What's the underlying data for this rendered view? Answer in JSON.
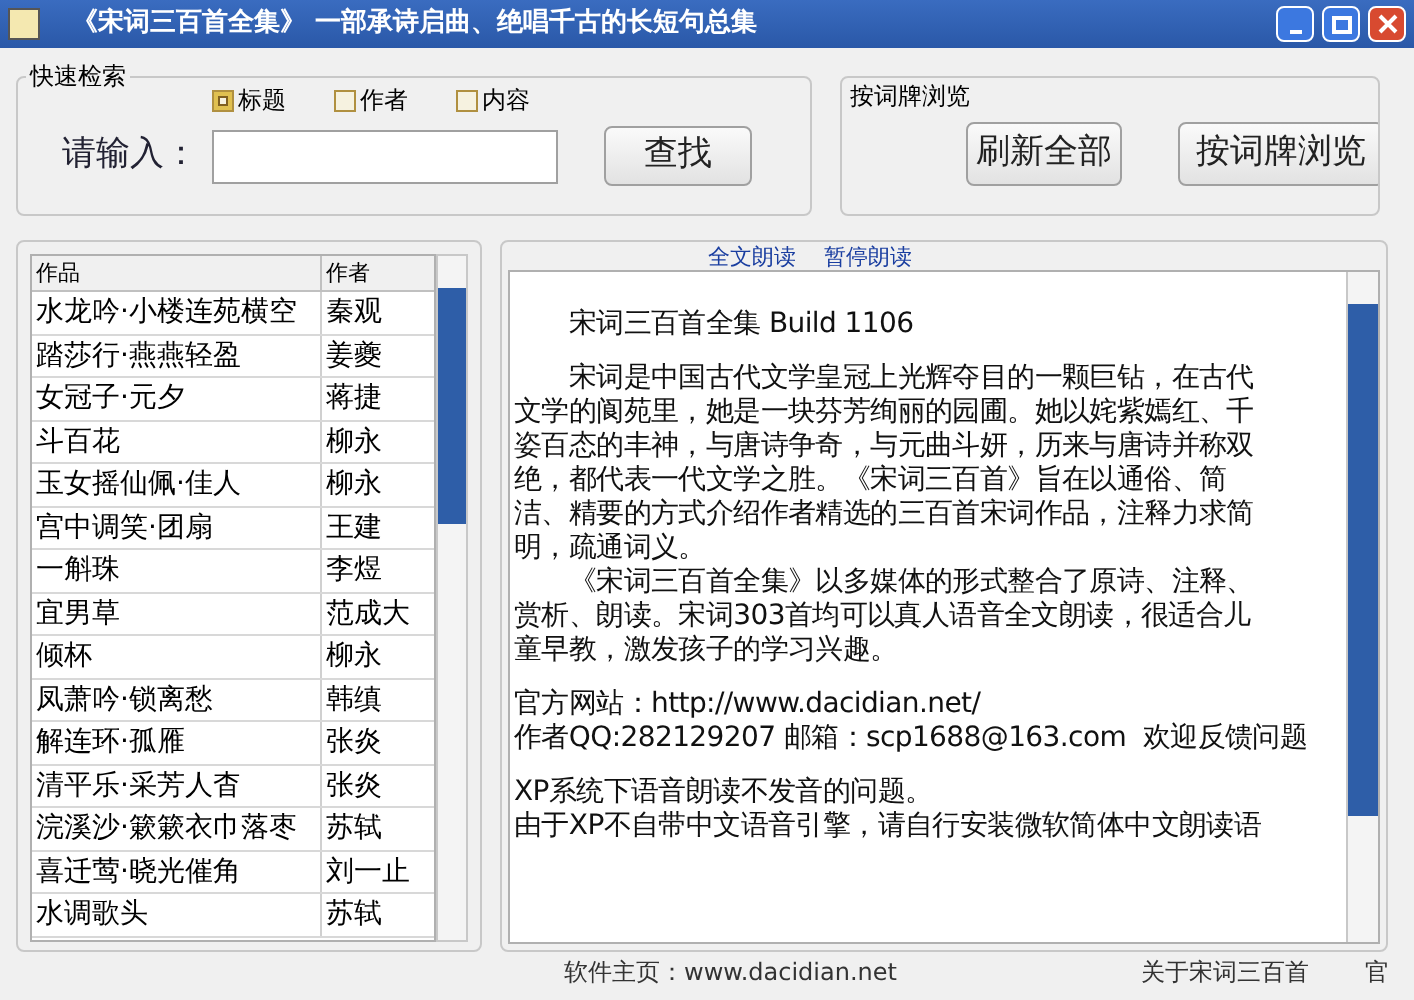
{
  "window": {
    "title": "《宋词三百首全集》 一部承诗启曲、绝唱千古的长短句总集"
  },
  "search": {
    "title": "快速检索",
    "options": [
      {
        "label": "标题",
        "checked": true
      },
      {
        "label": "作者",
        "checked": false
      },
      {
        "label": "内容",
        "checked": false
      }
    ],
    "prompt": "请输入：",
    "button": "查找"
  },
  "browse": {
    "title": "按词牌浏览",
    "buttons": [
      "刷新全部",
      "按词牌浏览"
    ]
  },
  "table": {
    "columns": [
      "作品",
      "作者"
    ],
    "rows": [
      {
        "title": "水龙吟·小楼连苑横空",
        "author": "秦观"
      },
      {
        "title": "踏莎行·燕燕轻盈",
        "author": "姜夔"
      },
      {
        "title": "女冠子·元夕",
        "author": "蒋捷"
      },
      {
        "title": "斗百花",
        "author": "柳永"
      },
      {
        "title": "玉女摇仙佩·佳人",
        "author": "柳永"
      },
      {
        "title": "宫中调笑·团扇",
        "author": "王建"
      },
      {
        "title": "一斛珠",
        "author": "李煜"
      },
      {
        "title": "宜男草",
        "author": "范成大"
      },
      {
        "title": "倾杯",
        "author": "柳永"
      },
      {
        "title": "凤萧吟·锁离愁",
        "author": "韩缜"
      },
      {
        "title": "解连环·孤雁",
        "author": "张炎"
      },
      {
        "title": "清平乐·采芳人杳",
        "author": "张炎"
      },
      {
        "title": "浣溪沙·簌簌衣巾落枣",
        "author": "苏轼"
      },
      {
        "title": "喜迁莺·晓光催角",
        "author": "刘一止"
      },
      {
        "title": "水调歌头",
        "author": "苏轼"
      }
    ]
  },
  "reader": {
    "tabs": [
      "全文朗读",
      "暂停朗读"
    ],
    "blocks": [
      [
        "　　宋词三百首全集 Build 1106"
      ],
      [
        "　　宋词是中国古代文学皇冠上光辉夺目的一颗巨钻，在古代",
        "文学的阆苑里，她是一块芬芳绚丽的园圃。她以姹紫嫣红、千",
        "姿百态的丰神，与唐诗争奇，与元曲斗妍，历来与唐诗并称双",
        "绝，都代表一代文学之胜。《宋词三百首》旨在以通俗、简",
        "洁、精要的方式介绍作者精选的三百首宋词作品，注释力求简",
        "明，疏通词义。",
        "　　《宋词三百首全集》以多媒体的形式整合了原诗、注释、",
        "赏析、朗读。宋词303首均可以真人语音全文朗读，很适合儿",
        "童早教，激发孩子的学习兴趣。"
      ],
      [
        "官方网站：http://www.dacidian.net/",
        "作者QQ:282129207 邮箱：scp1688@163.com  欢迎反馈问题"
      ],
      [
        "XP系统下语音朗读不发音的问题。",
        "由于XP不自带中文语音引擎，请自行安装微软简体中文朗读语"
      ]
    ]
  },
  "footer": [
    "软件主页：www.dacidian.net",
    "关于宋词三百首",
    "官"
  ]
}
